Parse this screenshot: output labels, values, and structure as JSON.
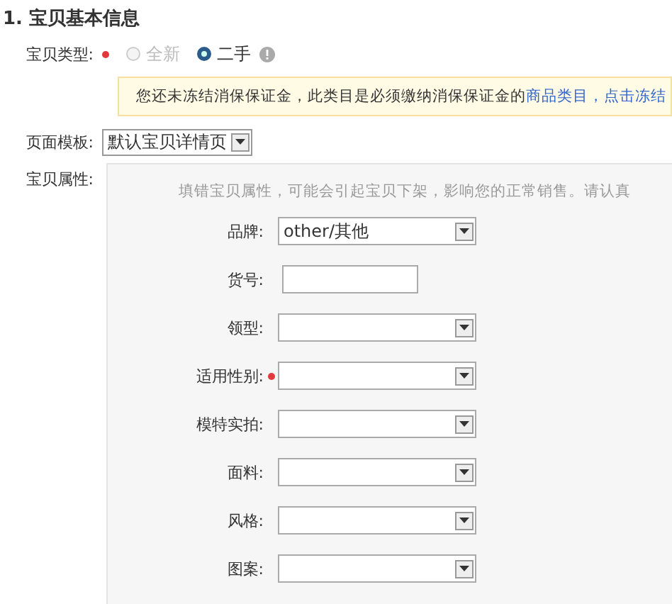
{
  "section_title": "1. 宝贝基本信息",
  "item_type": {
    "label": "宝贝类型:",
    "required": true,
    "options": [
      {
        "label": "全新",
        "selected": false,
        "disabled": true
      },
      {
        "label": "二手",
        "selected": true,
        "disabled": false
      }
    ]
  },
  "notice": {
    "text": "您还未冻结消保保证金，此类目是必须缴纳消保保证金的",
    "link": "商品类目",
    "action": "，点击冻结"
  },
  "template": {
    "label": "页面模板:",
    "value": "默认宝贝详情页"
  },
  "attributes": {
    "label": "宝贝属性:",
    "hint": "填错宝贝属性，可能会引起宝贝下架，影响您的正常销售。请认真",
    "fields": [
      {
        "label": "品牌:",
        "kind": "select",
        "required": false,
        "value": "other/其他"
      },
      {
        "label": "货号:",
        "kind": "text",
        "required": false
      },
      {
        "label": "领型:",
        "kind": "select",
        "required": false
      },
      {
        "label": "适用性别:",
        "kind": "select",
        "required": true
      },
      {
        "label": "模特实拍:",
        "kind": "select",
        "required": false
      },
      {
        "label": "面料:",
        "kind": "select",
        "required": false
      },
      {
        "label": "风格:",
        "kind": "select",
        "required": false
      },
      {
        "label": "图案:",
        "kind": "select",
        "required": false
      }
    ]
  }
}
